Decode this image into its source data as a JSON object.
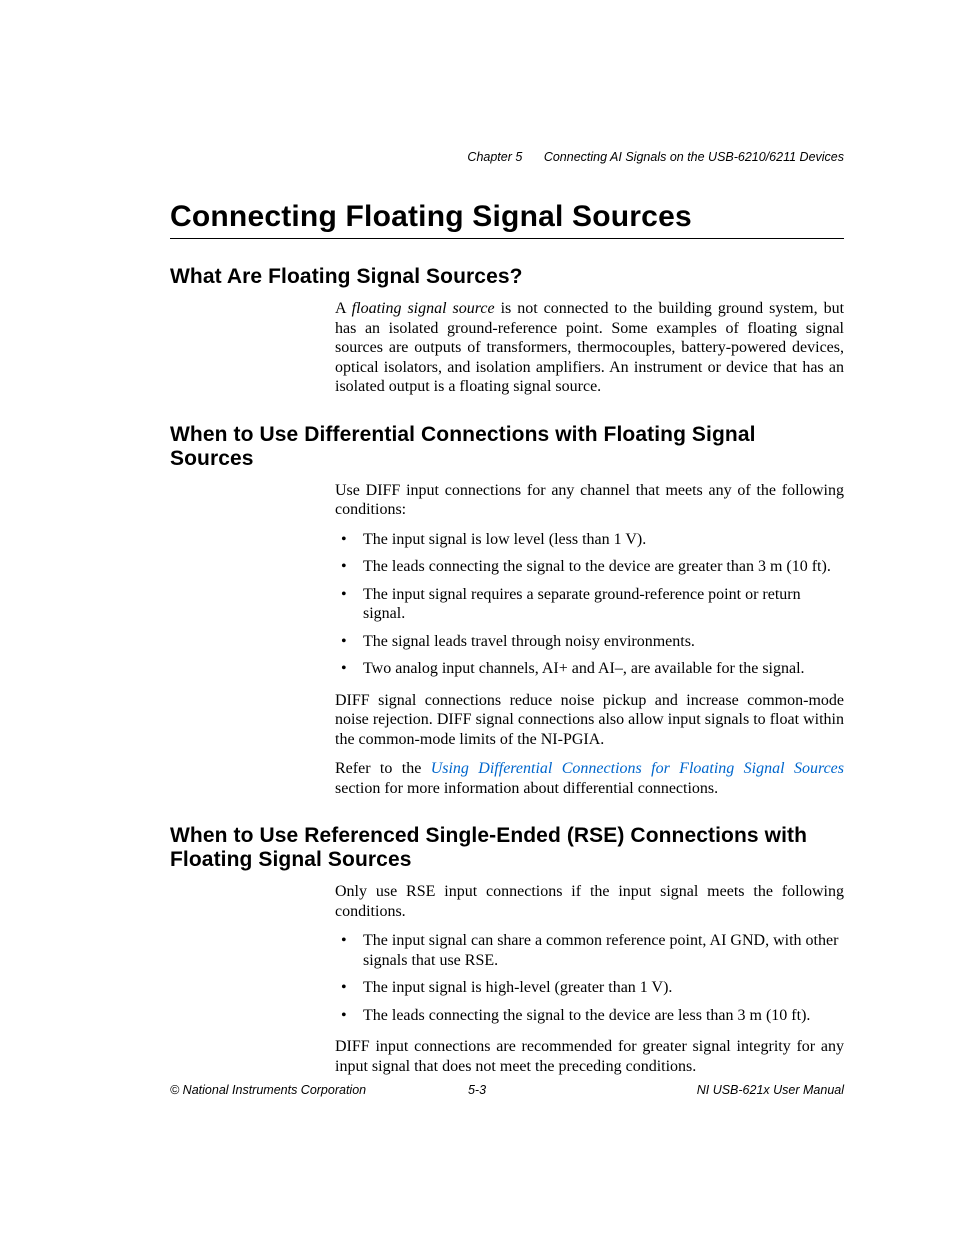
{
  "header": {
    "chapter_label": "Chapter 5",
    "chapter_title": "Connecting AI Signals on the USB-6210/6211 Devices"
  },
  "h1": "Connecting Floating Signal Sources",
  "section1": {
    "heading": "What Are Floating Signal Sources?",
    "p1_pre": "A ",
    "p1_term": "floating signal source",
    "p1_post": " is not connected to the building ground system, but has an isolated ground-reference point. Some examples of floating signal sources are outputs of transformers, thermocouples, battery-powered devices, optical isolators, and isolation amplifiers. An instrument or device that has an isolated output is a floating signal source."
  },
  "section2": {
    "heading": "When to Use Differential Connections with Floating Signal Sources",
    "intro": "Use DIFF input connections for any channel that meets any of the following conditions:",
    "bullets": [
      "The input signal is low level (less than 1 V).",
      "The leads connecting the signal to the device are greater than 3 m (10 ft).",
      "The input signal requires a separate ground-reference point or return signal.",
      "The signal leads travel through noisy environments.",
      "Two analog input channels, AI+ and AI–, are available for the signal."
    ],
    "p2": "DIFF signal connections reduce noise pickup and increase common-mode noise rejection. DIFF signal connections also allow input signals to float within the common-mode limits of the NI-PGIA.",
    "p3_pre": "Refer to the ",
    "p3_link": "Using Differential Connections for Floating Signal Sources",
    "p3_post": " section for more information about differential connections."
  },
  "section3": {
    "heading": "When to Use Referenced Single-Ended (RSE) Connections with Floating Signal Sources",
    "intro": "Only use RSE input connections if the input signal meets the following conditions.",
    "bullets": [
      "The input signal can share a common reference point, AI GND, with other signals that use RSE.",
      "The input signal is high-level (greater than 1 V).",
      "The leads connecting the signal to the device are less than 3 m (10 ft)."
    ],
    "p2": "DIFF input connections are recommended for greater signal integrity for any input signal that does not meet the preceding conditions."
  },
  "footer": {
    "left": "© National Instruments Corporation",
    "center": "5-3",
    "right": "NI USB-621x User Manual"
  }
}
